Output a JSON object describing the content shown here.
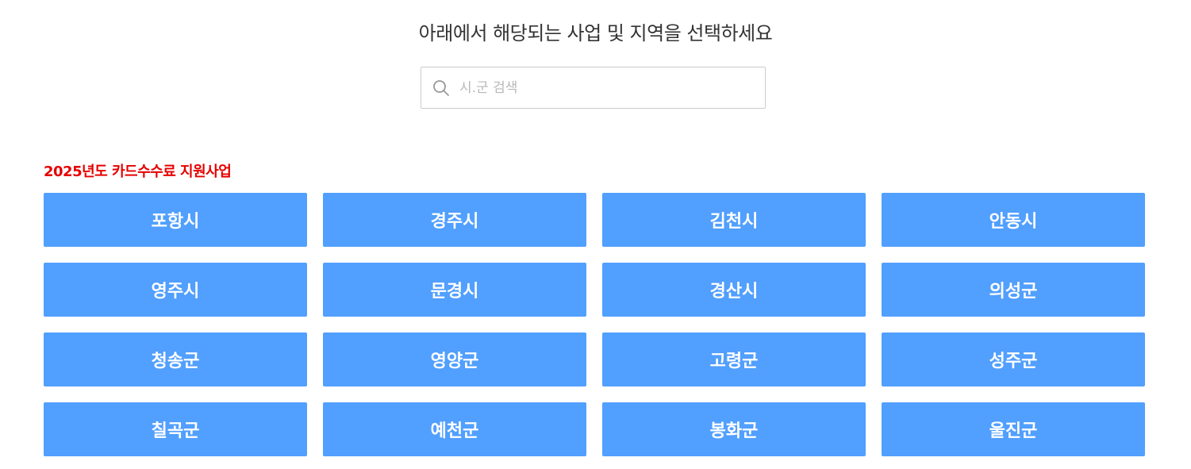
{
  "header": {
    "instruction": "아래에서 해당되는 사업 및 지역을 선택하세요"
  },
  "search": {
    "placeholder": "시.군 검색",
    "value": "",
    "icon": "search-icon"
  },
  "section": {
    "title": "2025년도 카드수수료 지원사업",
    "title_color": "#e60000"
  },
  "button_color": "#519ffe",
  "regions": [
    "포항시",
    "경주시",
    "김천시",
    "안동시",
    "영주시",
    "문경시",
    "경산시",
    "의성군",
    "청송군",
    "영양군",
    "고령군",
    "성주군",
    "칠곡군",
    "예천군",
    "봉화군",
    "울진군"
  ]
}
